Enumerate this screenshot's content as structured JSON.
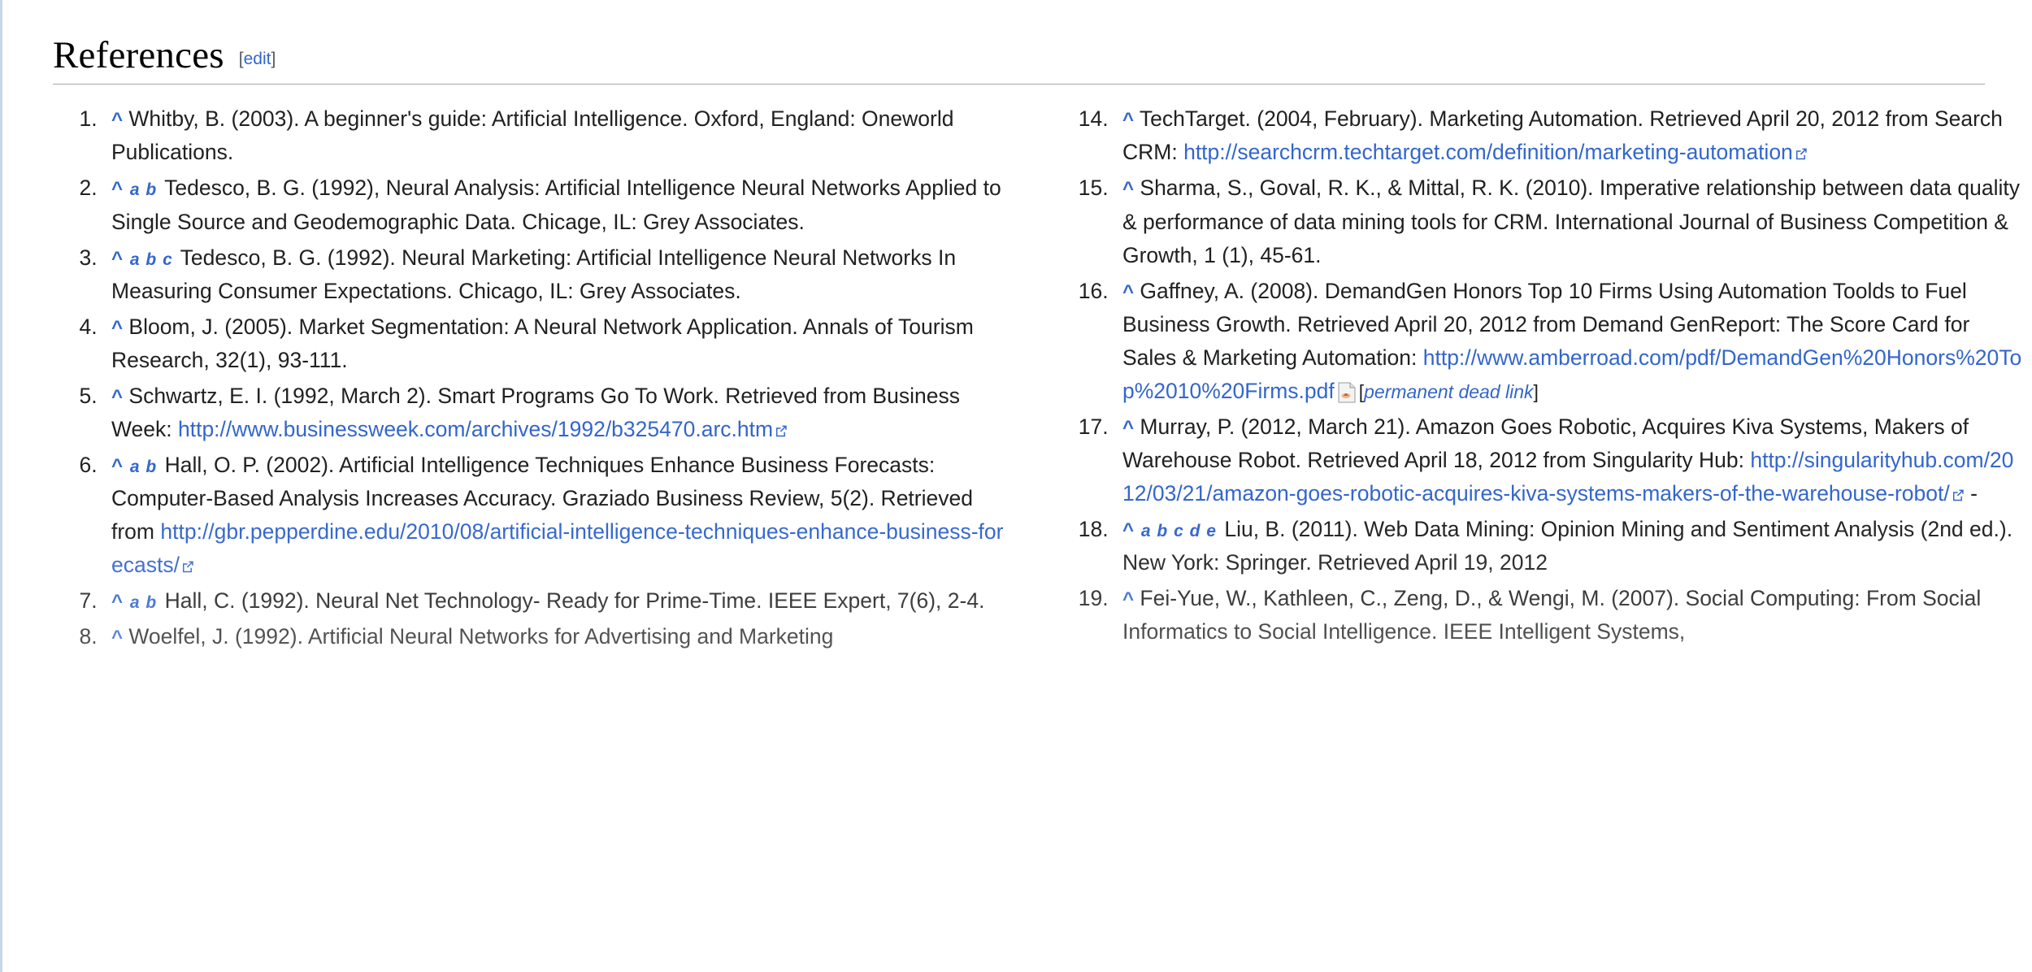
{
  "section": {
    "title": "References",
    "edit_open_bracket": "[",
    "edit_label": "edit",
    "edit_close_bracket": "]"
  },
  "icons": {
    "external_link": "external-link-icon",
    "pdf": "pdf-document-icon",
    "backlink_caret": "^"
  },
  "colors": {
    "link": "#3366cc",
    "text": "#202122",
    "rule": "#a2a9b1",
    "page_edge": "#c8d6e5"
  },
  "dead_link_note": {
    "open_bracket": "[",
    "label": "permanent dead link",
    "close_bracket": "]"
  },
  "left_column": [
    {
      "number": "1",
      "caret": "^",
      "letters": [],
      "parts": [
        {
          "type": "text",
          "value": "Whitby, B. (2003). A beginner's guide: Artificial Intelligence. Oxford, England: Oneworld Publications."
        }
      ]
    },
    {
      "number": "2",
      "caret": "^",
      "letters": [
        "a",
        "b"
      ],
      "parts": [
        {
          "type": "text",
          "value": "Tedesco, B. G. (1992), Neural Analysis: Artificial Intelligence Neural Networks Applied to Single Source and Geodemographic Data. Chicage, IL: Grey Associates."
        }
      ]
    },
    {
      "number": "3",
      "caret": "^",
      "letters": [
        "a",
        "b",
        "c"
      ],
      "parts": [
        {
          "type": "text",
          "value": "Tedesco, B. G. (1992). Neural Marketing: Artificial Intelligence Neural Networks In Measuring Consumer Expectations. Chicago, IL: Grey Associates."
        }
      ]
    },
    {
      "number": "4",
      "caret": "^",
      "letters": [],
      "parts": [
        {
          "type": "text",
          "value": "Bloom, J. (2005). Market Segmentation: A Neural Network Application. Annals of Tourism Research, 32(1), 93-111."
        }
      ]
    },
    {
      "number": "5",
      "caret": "^",
      "letters": [],
      "parts": [
        {
          "type": "text",
          "value": "Schwartz, E. I. (1992, March 2). Smart Programs Go To Work. Retrieved from Business Week: "
        },
        {
          "type": "link",
          "value": "http://www.businessweek.com/archives/1992/b325470.arc.htm",
          "external_icon": true
        }
      ]
    },
    {
      "number": "6",
      "caret": "^",
      "letters": [
        "a",
        "b"
      ],
      "parts": [
        {
          "type": "text",
          "value": "Hall, O. P. (2002). Artificial Intelligence Techniques Enhance Business Forecasts: Computer-Based Analysis Increases Accuracy. Graziado Business Review, 5(2). Retrieved from "
        },
        {
          "type": "link",
          "value": "http://gbr.pepperdine.edu/2010/08/artificial-intelligence-techniques-enhance-business-forecasts/",
          "external_icon": true
        }
      ]
    },
    {
      "number": "7",
      "caret": "^",
      "letters": [
        "a",
        "b"
      ],
      "parts": [
        {
          "type": "text",
          "value": "Hall, C. (1992). Neural Net Technology- Ready for Prime-Time. IEEE Expert, 7(6), 2-4."
        }
      ]
    },
    {
      "number": "8",
      "caret": "^",
      "letters": [],
      "parts": [
        {
          "type": "text",
          "value": "Woelfel, J. (1992). Artificial Neural Networks for Advertising and Marketing"
        }
      ]
    }
  ],
  "right_column": [
    {
      "number": "14",
      "caret": "^",
      "letters": [],
      "parts": [
        {
          "type": "text",
          "value": "TechTarget. (2004, February). Marketing Automation. Retrieved April 20, 2012 from Search CRM: "
        },
        {
          "type": "link",
          "value": "http://searchcrm.techtarget.com/definition/marketing-automation",
          "external_icon": true
        }
      ]
    },
    {
      "number": "15",
      "caret": "^",
      "letters": [],
      "parts": [
        {
          "type": "text",
          "value": "Sharma, S., Goval, R. K., & Mittal, R. K. (2010). Imperative relationship between data quality & performance of data mining tools for CRM. International Journal of Business Competition & Growth, 1 (1), 45-61."
        }
      ]
    },
    {
      "number": "16",
      "caret": "^",
      "letters": [],
      "parts": [
        {
          "type": "text",
          "value": "Gaffney, A. (2008). DemandGen Honors Top 10 Firms Using Automation Toolds to Fuel Business Growth. Retrieved April 20, 2012 from Demand GenReport: The Score Card for Sales & Marketing Automation: "
        },
        {
          "type": "link",
          "value": "http://www.amberroad.com/pdf/DemandGen%20Honors%20Top%2010%20Firms.pdf",
          "external_icon": false
        },
        {
          "type": "pdf_dead_link"
        }
      ]
    },
    {
      "number": "17",
      "caret": "^",
      "letters": [],
      "parts": [
        {
          "type": "text",
          "value": "Murray, P. (2012, March 21). Amazon Goes Robotic, Acquires Kiva Systems, Makers of Warehouse Robot. Retrieved April 18, 2012 from Singularity Hub: "
        },
        {
          "type": "link",
          "value": "http://singularityhub.com/2012/03/21/amazon-goes-robotic-acquires-kiva-systems-makers-of-the-warehouse-robot/",
          "external_icon": true
        },
        {
          "type": "text",
          "value": " -"
        }
      ]
    },
    {
      "number": "18",
      "caret": "^",
      "letters": [
        "a",
        "b",
        "c",
        "d",
        "e"
      ],
      "parts": [
        {
          "type": "text",
          "value": "Liu, B. (2011). Web Data Mining: Opinion Mining and Sentiment Analysis (2nd ed.). New York: Springer. Retrieved April 19, 2012"
        }
      ]
    },
    {
      "number": "19",
      "caret": "^",
      "letters": [],
      "parts": [
        {
          "type": "text",
          "value": "Fei-Yue, W., Kathleen, C., Zeng, D., & Wengi, M. (2007). Social Computing: From Social Informatics to Social Intelligence. IEEE Intelligent Systems,"
        }
      ]
    }
  ]
}
